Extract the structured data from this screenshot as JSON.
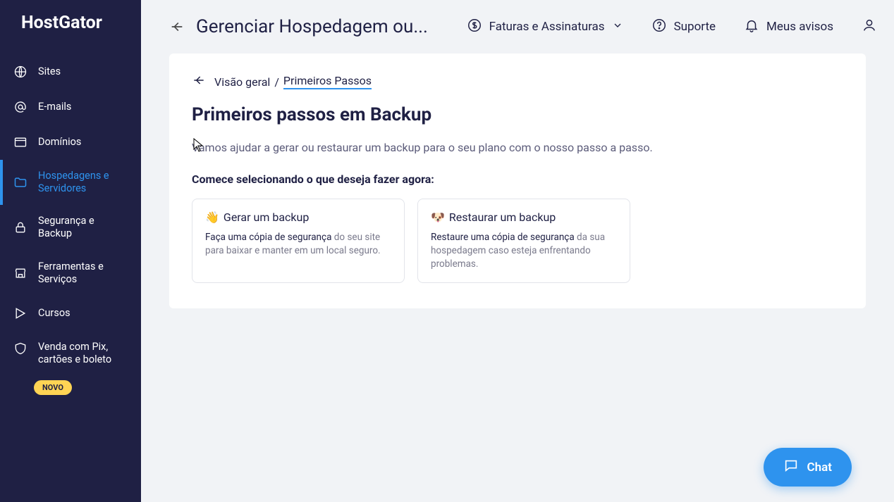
{
  "brand": {
    "name": "HostGator"
  },
  "sidebar": {
    "items": [
      {
        "label": "Sites"
      },
      {
        "label": "E-mails"
      },
      {
        "label": "Domínios"
      },
      {
        "label": "Hospedagens e Servidores"
      },
      {
        "label": "Segurança e Backup"
      },
      {
        "label": "Ferramentas e Serviços"
      },
      {
        "label": "Cursos"
      },
      {
        "label": "Venda com Pix, cartões e boleto"
      }
    ],
    "badge_novo": "NOVO"
  },
  "topbar": {
    "title": "Gerenciar Hospedagem ou...",
    "billing": "Faturas e Assinaturas",
    "support": "Suporte",
    "notices": "Meus avisos"
  },
  "breadcrumb": {
    "root": "Visão geral",
    "sep": "/",
    "current": "Primeiros Passos"
  },
  "page": {
    "title": "Primeiros passos em Backup",
    "description": "Vamos ajudar a gerar ou restaurar um backup para o seu plano com o nosso passo a passo.",
    "section_heading": "Comece selecionando o que deseja fazer agora:"
  },
  "options": [
    {
      "emoji": "👋",
      "title": "Gerar um backup",
      "desc_lead": "Faça uma cópia de segurança",
      "desc_rest": " do seu site para baixar e manter em um local seguro."
    },
    {
      "emoji": "🐶",
      "title": "Restaurar um backup",
      "desc_lead": "Restaure uma cópia de segurança",
      "desc_rest": " da sua hospedagem caso esteja enfrentando problemas."
    }
  ],
  "chat": {
    "label": "Chat"
  }
}
